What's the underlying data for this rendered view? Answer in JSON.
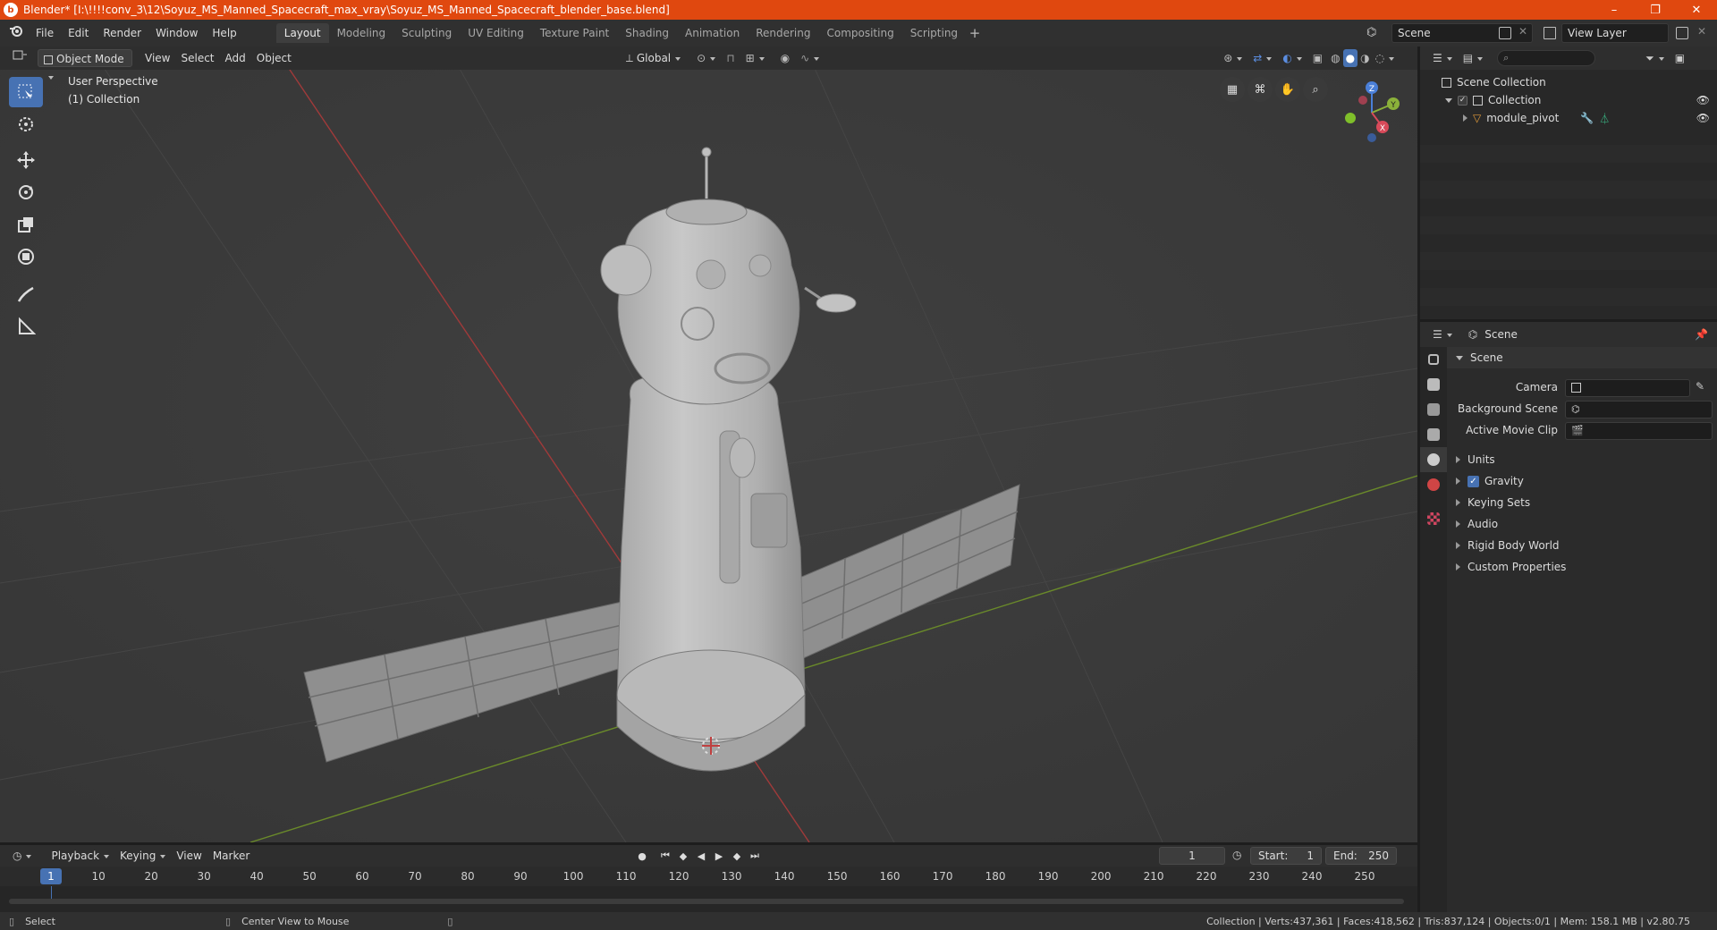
{
  "window": {
    "title": "Blender* [I:\\!!!!conv_3\\12\\Soyuz_MS_Manned_Spacecraft_max_vray\\Soyuz_MS_Manned_Spacecraft_blender_base.blend]",
    "minimize": "–",
    "maximize": "❐",
    "close": "✕"
  },
  "menu": [
    "File",
    "Edit",
    "Render",
    "Window",
    "Help"
  ],
  "workspaces": [
    "Layout",
    "Modeling",
    "Sculpting",
    "UV Editing",
    "Texture Paint",
    "Shading",
    "Animation",
    "Rendering",
    "Compositing",
    "Scripting"
  ],
  "workspace_add": "+",
  "scene_name": "Scene",
  "view_layer": "View Layer",
  "viewport": {
    "mode": "Object Mode",
    "menus": [
      "View",
      "Select",
      "Add",
      "Object"
    ],
    "orientation": "Global",
    "overlay_title": "User Perspective",
    "overlay_collection": "(1) Collection",
    "gizmo": {
      "x": "X",
      "y": "Y",
      "z": "Z"
    }
  },
  "outliner": {
    "root": "Scene Collection",
    "collection": "Collection",
    "object": "module_pivot"
  },
  "properties": {
    "context": "Scene",
    "section": "Scene",
    "fields": [
      {
        "label": "Camera",
        "value": ""
      },
      {
        "label": "Background Scene",
        "value": ""
      },
      {
        "label": "Active Movie Clip",
        "value": ""
      }
    ],
    "subsections": [
      "Units",
      "Gravity",
      "Keying Sets",
      "Audio",
      "Rigid Body World",
      "Custom Properties"
    ]
  },
  "timeline": {
    "menus": [
      "Playback",
      "Keying",
      "View",
      "Marker"
    ],
    "current_frame": "1",
    "start_label": "Start:",
    "start": "1",
    "end_label": "End:",
    "end": "250",
    "ticks": [
      "10",
      "20",
      "30",
      "40",
      "50",
      "60",
      "70",
      "80",
      "90",
      "100",
      "110",
      "120",
      "130",
      "140",
      "150",
      "160",
      "170",
      "180",
      "190",
      "200",
      "210",
      "220",
      "230",
      "240",
      "250"
    ]
  },
  "status": {
    "left": "Select",
    "middle": "Center View to Mouse",
    "right": "Collection | Verts:437,361 | Faces:418,562 | Tris:837,124 | Objects:0/1 | Mem: 158.1 MB | v2.80.75"
  }
}
